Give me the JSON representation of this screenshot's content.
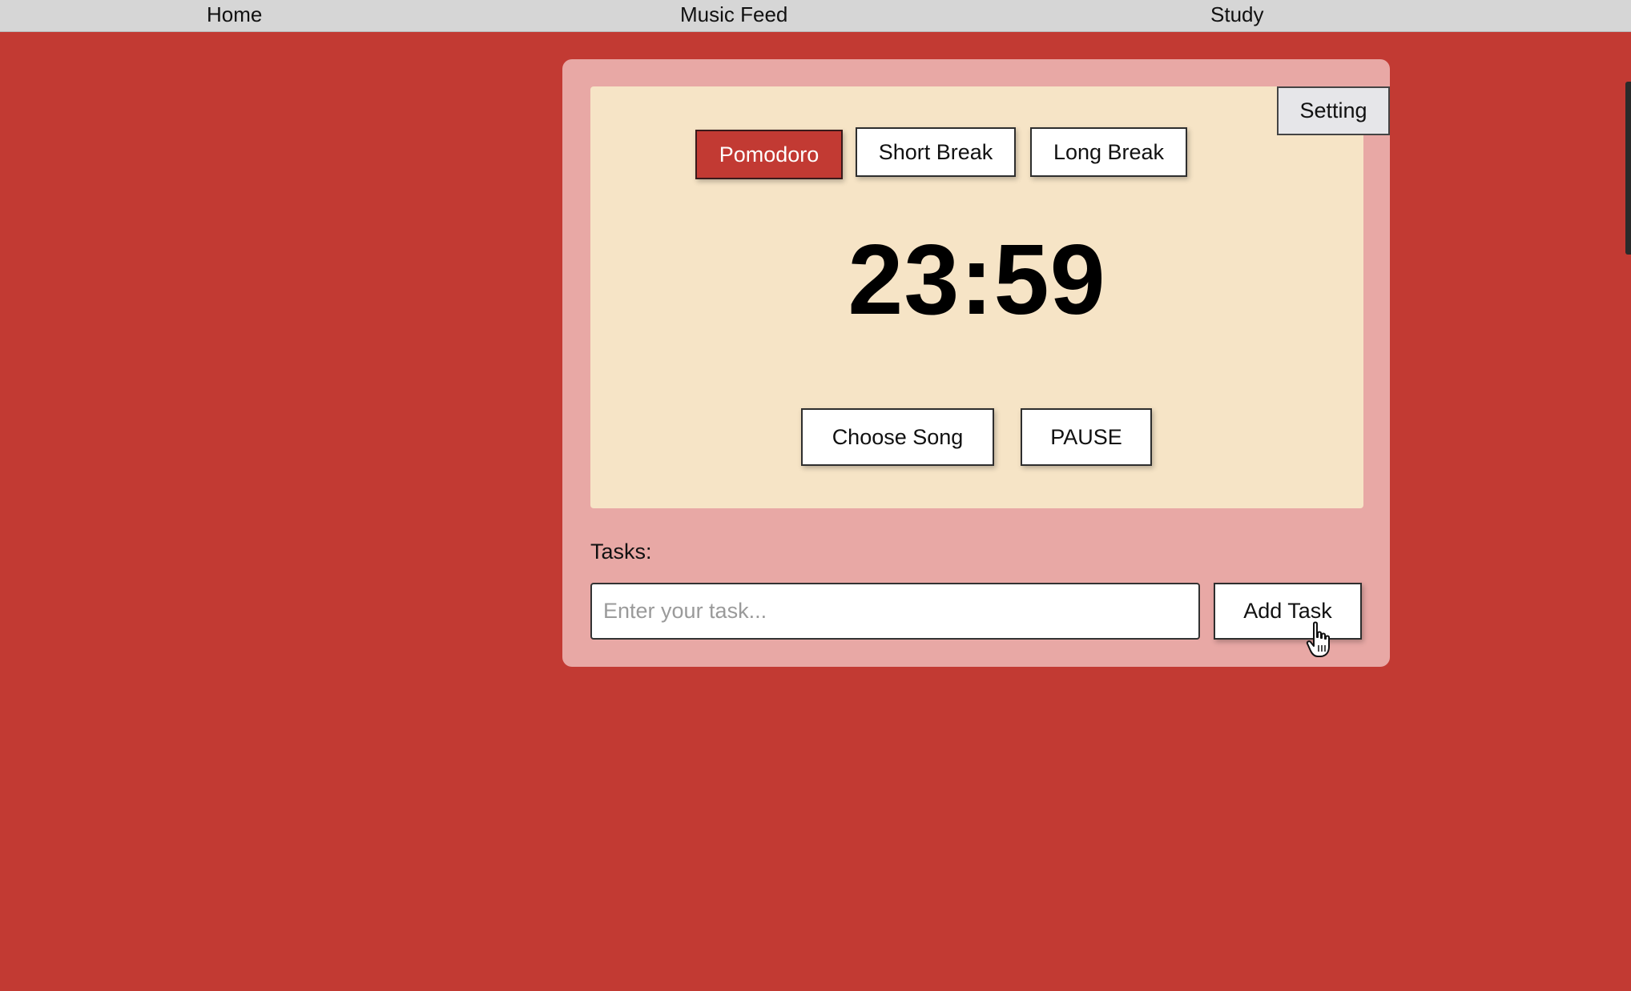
{
  "nav": {
    "items": [
      {
        "label": "Home"
      },
      {
        "label": "Music Feed"
      },
      {
        "label": "Study"
      }
    ]
  },
  "timer_card": {
    "setting_label": "Setting",
    "modes": [
      {
        "label": "Pomodoro",
        "active": true
      },
      {
        "label": "Short Break",
        "active": false
      },
      {
        "label": "Long Break",
        "active": false
      }
    ],
    "time": "23:59",
    "choose_song_label": "Choose Song",
    "pause_label": "PAUSE"
  },
  "tasks": {
    "label": "Tasks:",
    "input_value": "",
    "input_placeholder": "Enter your task...",
    "add_label": "Add Task"
  },
  "colors": {
    "background": "#c23a33",
    "card": "#e8a8a5",
    "panel": "#f6e4c6",
    "active_mode": "#c23a33",
    "nav": "#d6d6d6"
  },
  "icons": {
    "cursor": "hand-pointer-icon"
  }
}
